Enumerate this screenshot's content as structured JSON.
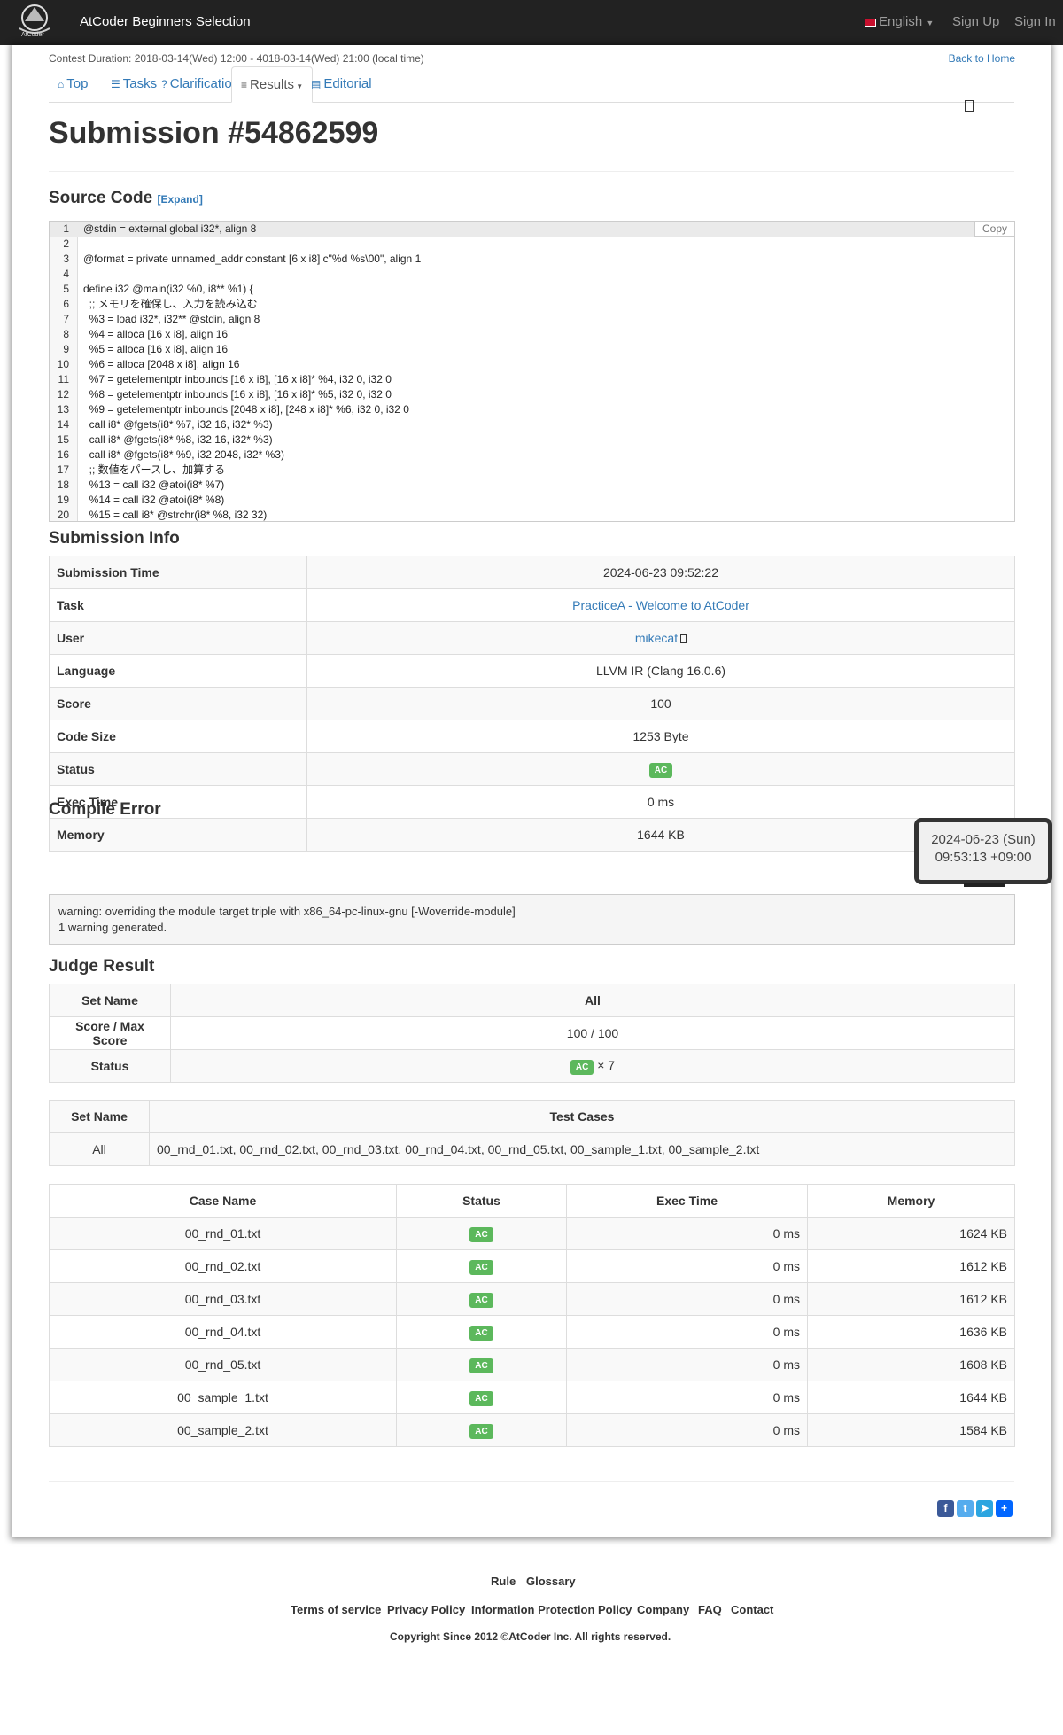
{
  "navbar": {
    "brand": "AtCoder Beginners Selection",
    "logo_text": "AtCoder",
    "language": "English",
    "sign_up": "Sign Up",
    "sign_in": "Sign In"
  },
  "contest": {
    "duration": "Contest Duration: 2018-03-14(Wed) 12:00 - 4018-03-14(Wed) 21:00 (local time)",
    "back": "Back to Home"
  },
  "tabs": [
    {
      "label": "Top"
    },
    {
      "label": "Tasks"
    },
    {
      "label": "Clarifications"
    },
    {
      "label": "Results"
    },
    {
      "label": "Editorial"
    }
  ],
  "title": "Submission #54862599",
  "source": {
    "heading": "Source Code",
    "expand": "[Expand]",
    "copy": "Copy",
    "lines": [
      "@stdin = external global i32*, align 8",
      "",
      "@format = private unnamed_addr constant [6 x i8] c\"%d %s\\00\", align 1",
      "",
      "define i32 @main(i32 %0, i8** %1) {",
      "  ;; メモリを確保し、入力を読み込む",
      "  %3 = load i32*, i32** @stdin, align 8",
      "  %4 = alloca [16 x i8], align 16",
      "  %5 = alloca [16 x i8], align 16",
      "  %6 = alloca [2048 x i8], align 16",
      "  %7 = getelementptr inbounds [16 x i8], [16 x i8]* %4, i32 0, i32 0",
      "  %8 = getelementptr inbounds [16 x i8], [16 x i8]* %5, i32 0, i32 0",
      "  %9 = getelementptr inbounds [2048 x i8], [248 x i8]* %6, i32 0, i32 0",
      "  call i8* @fgets(i8* %7, i32 16, i32* %3)",
      "  call i8* @fgets(i8* %8, i32 16, i32* %3)",
      "  call i8* @fgets(i8* %9, i32 2048, i32* %3)",
      "  ;; 数値をパースし、加算する",
      "  %13 = call i32 @atoi(i8* %7)",
      "  %14 = call i32 @atoi(i8* %8)",
      "  %15 = call i8* @strchr(i8* %8, i32 32)"
    ]
  },
  "info": {
    "heading": "Submission Info",
    "rows": [
      {
        "k": "Submission Time",
        "v": "2024-06-23 09:52:22"
      },
      {
        "k": "Task",
        "v": "PracticeA - Welcome to AtCoder"
      },
      {
        "k": "User",
        "v": "mikecat"
      },
      {
        "k": "Language",
        "v": "LLVM IR (Clang 16.0.6)"
      },
      {
        "k": "Score",
        "v": "100"
      },
      {
        "k": "Code Size",
        "v": "1253 Byte"
      },
      {
        "k": "Status",
        "v": "AC"
      },
      {
        "k": "Exec Time",
        "v": "0 ms"
      },
      {
        "k": "Memory",
        "v": "1644 KB"
      }
    ]
  },
  "tooltip": {
    "line1": "2024-06-23 (Sun)",
    "line2": "09:53:13 +09:00"
  },
  "compile": {
    "heading": "Compile Error",
    "line1": "warning: overriding the module target triple with x86_64-pc-linux-gnu [-Woverride-module]",
    "line2": "1 warning generated."
  },
  "judge": {
    "heading": "Judge Result",
    "set_name": "Set Name",
    "all": "All",
    "score_label": "Score / Max Score",
    "score": "100 / 100",
    "status_label": "Status",
    "status": "AC",
    "times": "× 7"
  },
  "testcases": {
    "set_name": "Set Name",
    "test_cases": "Test Cases",
    "set": "All",
    "cases": "00_rnd_01.txt, 00_rnd_02.txt, 00_rnd_03.txt, 00_rnd_04.txt, 00_rnd_05.txt, 00_sample_1.txt, 00_sample_2.txt"
  },
  "results": {
    "headers": [
      "Case Name",
      "Status",
      "Exec Time",
      "Memory"
    ],
    "rows": [
      {
        "name": "00_rnd_01.txt",
        "status": "AC",
        "time": "0 ms",
        "mem": "1624 KB"
      },
      {
        "name": "00_rnd_02.txt",
        "status": "AC",
        "time": "0 ms",
        "mem": "1612 KB"
      },
      {
        "name": "00_rnd_03.txt",
        "status": "AC",
        "time": "0 ms",
        "mem": "1612 KB"
      },
      {
        "name": "00_rnd_04.txt",
        "status": "AC",
        "time": "0 ms",
        "mem": "1636 KB"
      },
      {
        "name": "00_rnd_05.txt",
        "status": "AC",
        "time": "0 ms",
        "mem": "1608 KB"
      },
      {
        "name": "00_sample_1.txt",
        "status": "AC",
        "time": "0 ms",
        "mem": "1644 KB"
      },
      {
        "name": "00_sample_2.txt",
        "status": "AC",
        "time": "0 ms",
        "mem": "1584 KB"
      }
    ]
  },
  "footer": {
    "rule": "Rule",
    "glossary": "Glossary",
    "terms": "Terms of service",
    "privacy": "Privacy Policy",
    "info_protect": "Information Protection Policy",
    "company": "Company",
    "faq": "FAQ",
    "contact": "Contact",
    "copyright_pre": "Copyright Since 2012 ©",
    "copyright_co": "AtCoder Inc.",
    "copyright_post": " All rights reserved."
  }
}
